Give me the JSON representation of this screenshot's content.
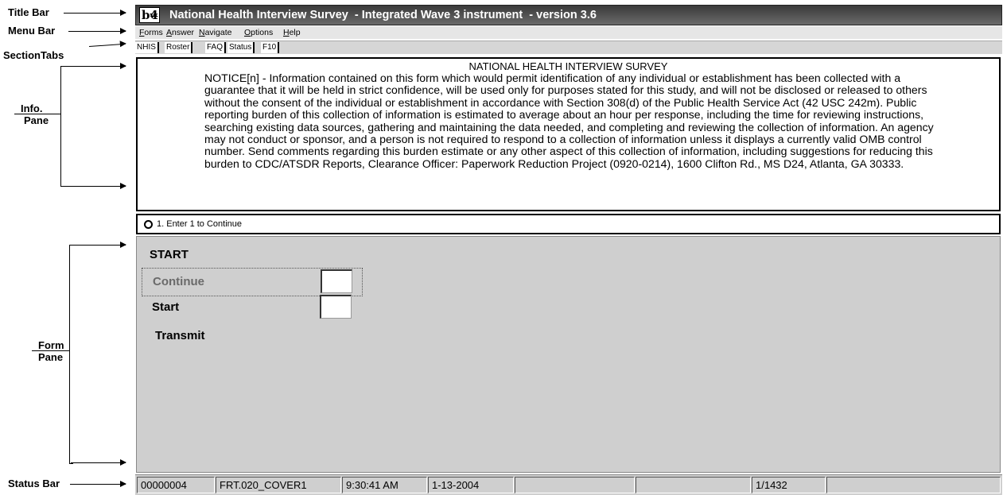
{
  "annotations": {
    "title_bar": "Title Bar",
    "menu_bar": "Menu Bar",
    "section_tabs": "SectionTabs",
    "info_pane": [
      "Info.",
      "Pane"
    ],
    "form_pane": [
      "Form",
      "Pane"
    ],
    "status_bar": "Status Bar"
  },
  "window": {
    "icon_text": "b4",
    "icon_sub": "w",
    "title": "National Health Interview Survey  - Integrated Wave 3 instrument  - version 3.6"
  },
  "menu": [
    {
      "label": "Forms",
      "u": "F",
      "rest": "orms"
    },
    {
      "label": "Answer",
      "u": "A",
      "rest": "nswer"
    },
    {
      "label": "Navigate",
      "u": "N",
      "rest": "avigate"
    },
    {
      "label": "Options",
      "u": "O",
      "rest": "ptions"
    },
    {
      "label": "Help",
      "u": "H",
      "rest": "elp"
    }
  ],
  "tabs": [
    "NHIS",
    "Roster",
    "FAQ",
    "Status",
    "F10"
  ],
  "info_pane": {
    "heading": "NATIONAL HEALTH INTERVIEW SURVEY",
    "body": "NOTICE[n] - Information contained on this form which would permit identification of any individual or establishment has been collected with a guarantee that it will be held in strict confidence, will be used only for purposes stated for this study, and will not be disclosed or released to others without the consent of the individual or establishment in accordance with Section 308(d) of the Public Health Service Act (42 USC 242m).  Public reporting burden of this collection of information is estimated to average about an hour per response, including the time for reviewing instructions, searching existing data sources, gathering and maintaining the data needed, and completing and reviewing the collection of information.  An agency may not conduct or sponsor, and a person is not required to respond to a collection of information unless it displays a currently valid OMB control number.  Send comments regarding this burden estimate or any other aspect of this collection of information, including suggestions for reducing this burden to CDC/ATSDR Reports, Clearance Officer: Paperwork Reduction Project (0920-0214), 1600 Clifton Rd., MS D24, Atlanta, GA  30333."
  },
  "answer_option": "1. Enter 1 to Continue",
  "form": {
    "heading": "START",
    "fields": [
      "Continue",
      "Start"
    ],
    "transmit_label": "Transmit",
    "values": [
      "",
      ""
    ]
  },
  "status": {
    "case_id": "00000004",
    "field_name": "FRT.020_COVER1",
    "time": "9:30:41 AM",
    "date": "1-13-2004",
    "blank1": "",
    "blank2": "",
    "page": "1/1432",
    "blank3": ""
  }
}
